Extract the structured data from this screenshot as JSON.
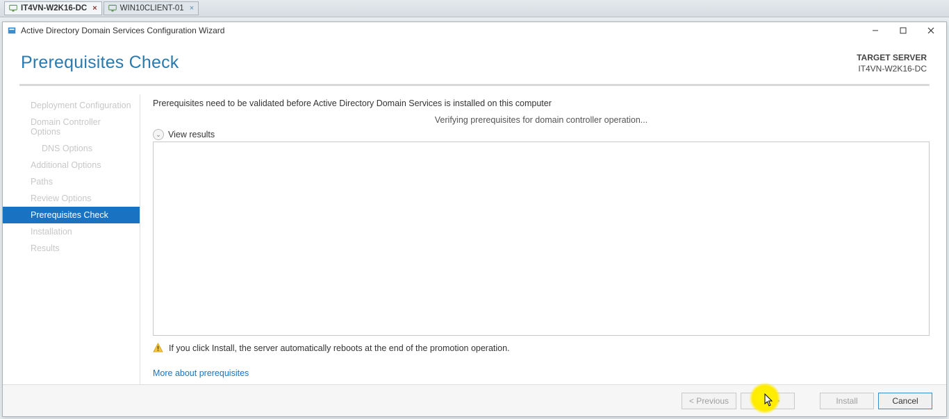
{
  "vm_tabs": {
    "active": "IT4VN-W2K16-DC",
    "inactive": "WIN10CLIENT-01"
  },
  "titlebar": {
    "title": "Active Directory Domain Services Configuration Wizard"
  },
  "header": {
    "page_title": "Prerequisites Check",
    "target_label": "TARGET SERVER",
    "target_value": "IT4VN-W2K16-DC"
  },
  "nav": {
    "items": [
      "Deployment Configuration",
      "Domain Controller Options",
      "DNS Options",
      "Additional Options",
      "Paths",
      "Review Options",
      "Prerequisites Check",
      "Installation",
      "Results"
    ]
  },
  "main": {
    "intro": "Prerequisites need to be validated before Active Directory Domain Services is installed on this computer",
    "status": "Verifying prerequisites for domain controller operation...",
    "view_results": "View results",
    "warning": "If you click Install, the server automatically reboots at the end of the promotion operation.",
    "more_link": "More about prerequisites"
  },
  "footer": {
    "previous": "< Previous",
    "next": "Next >",
    "install": "Install",
    "cancel": "Cancel"
  }
}
